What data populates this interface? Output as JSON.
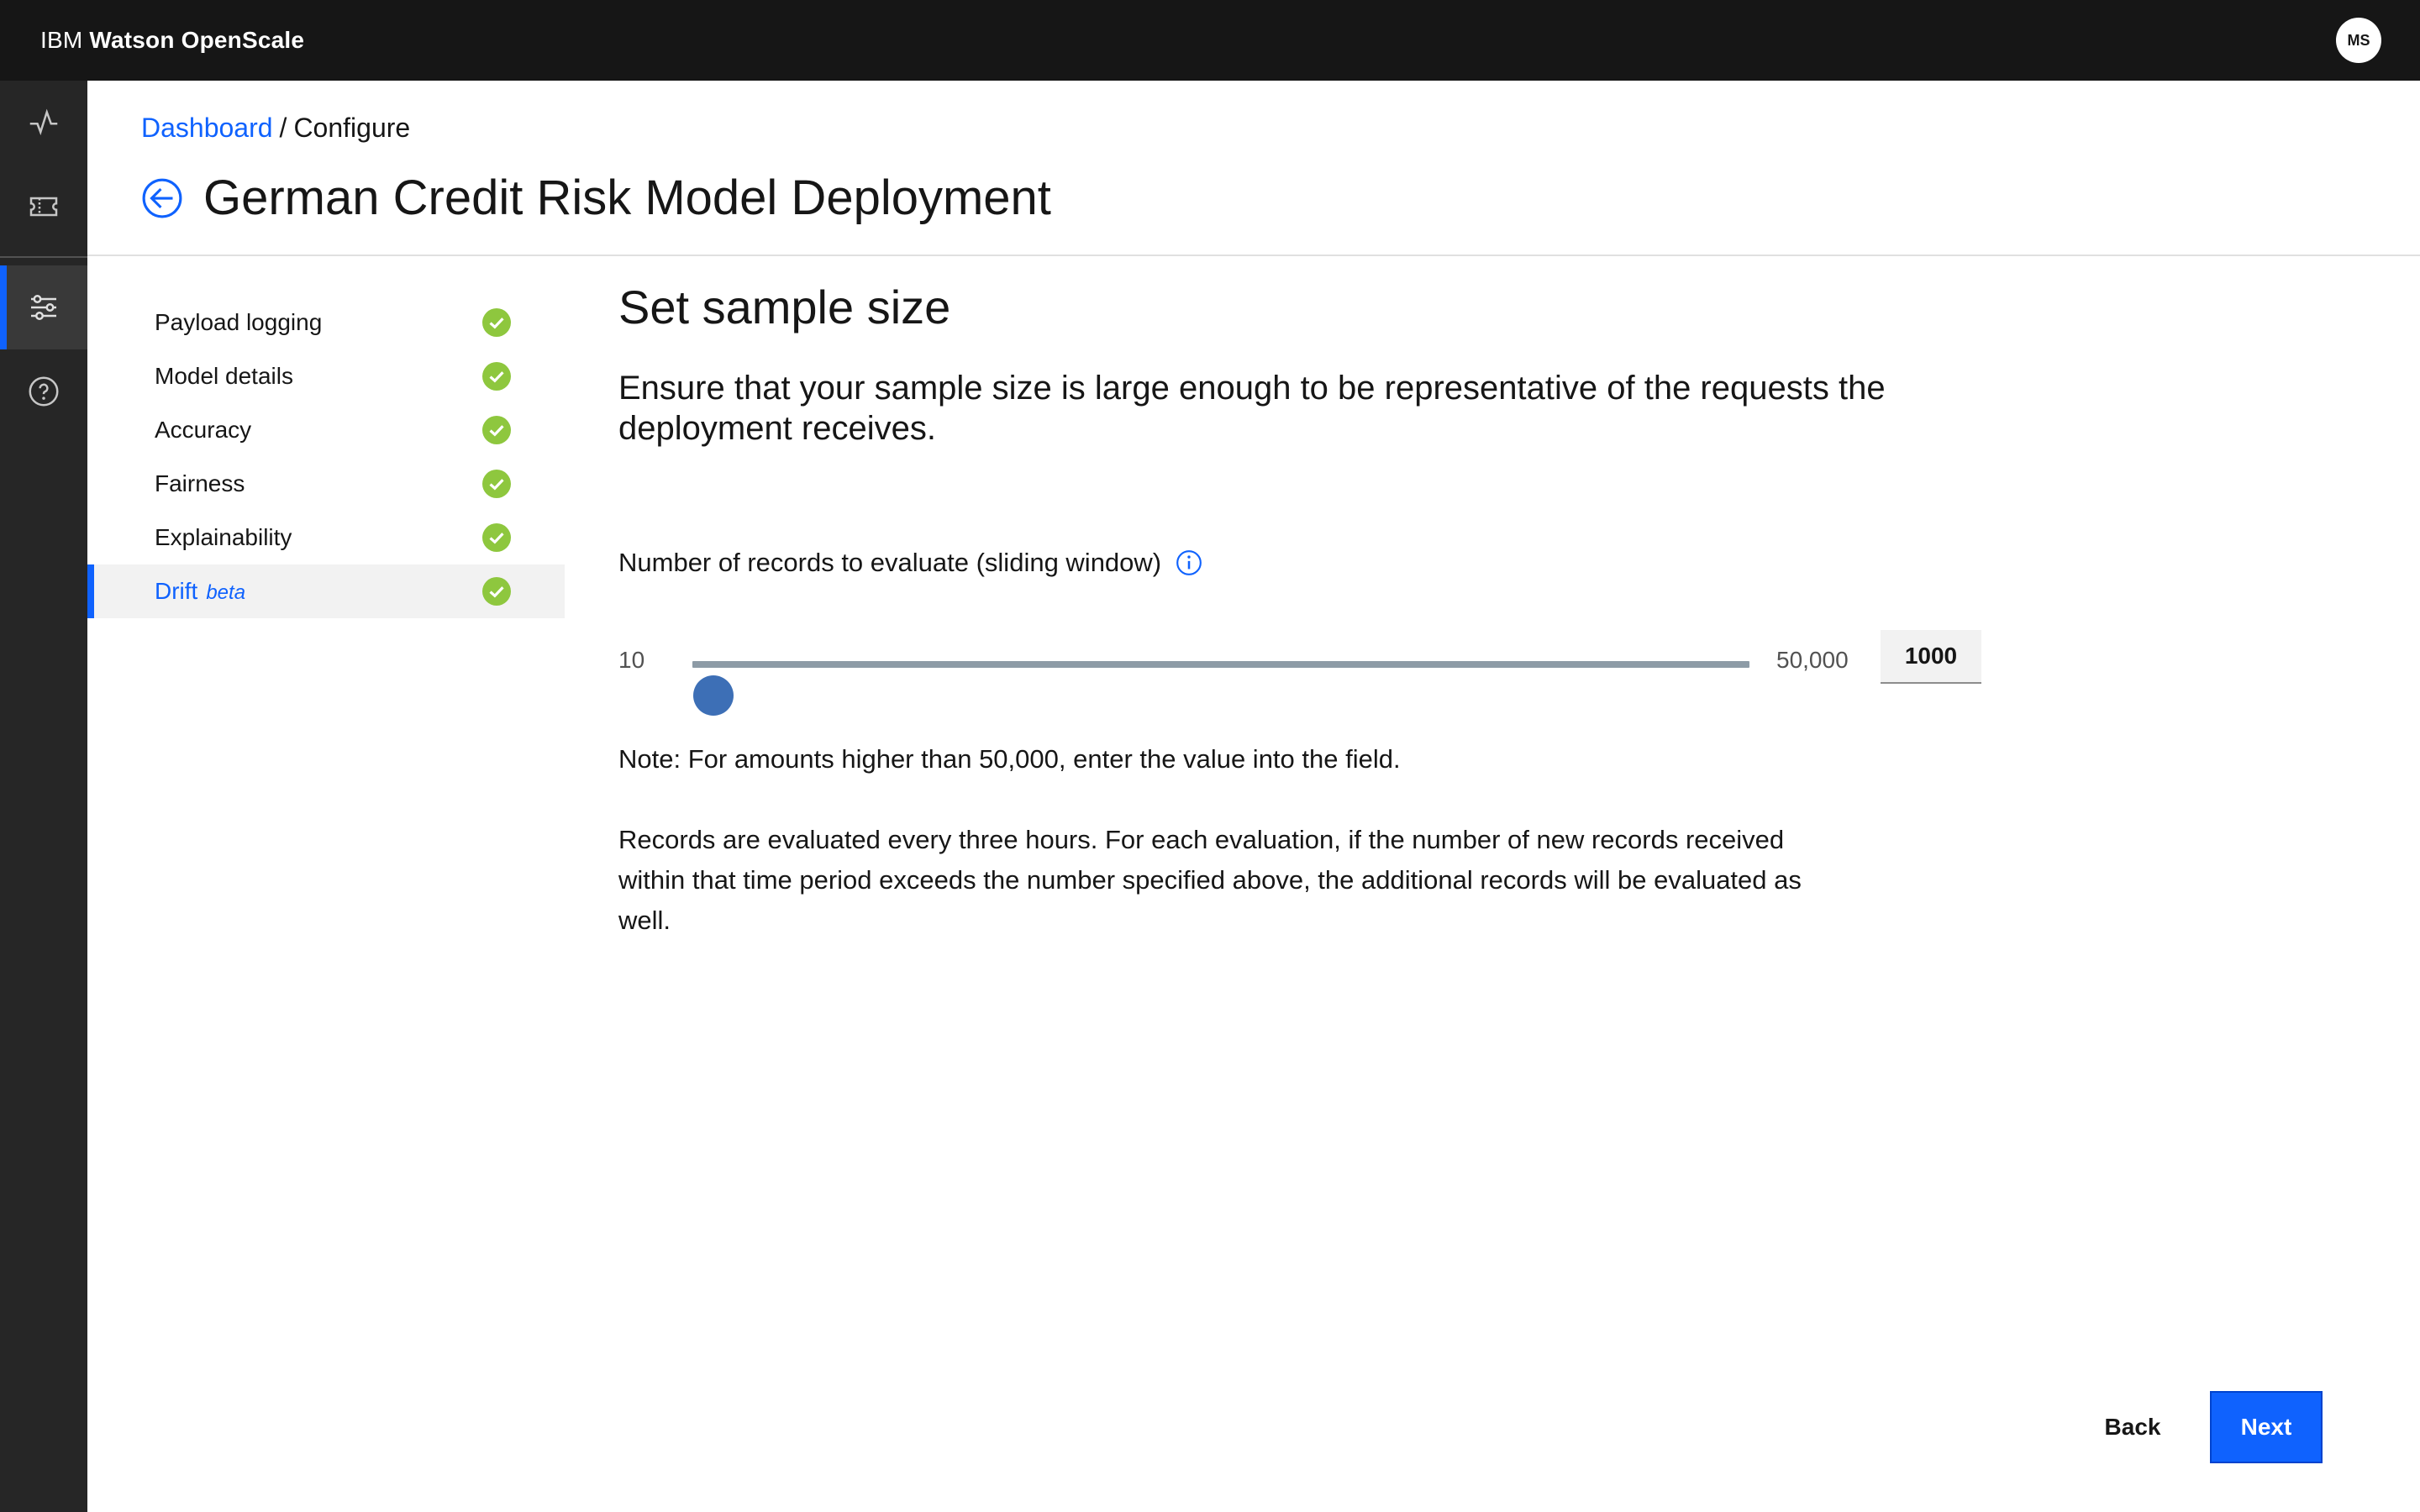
{
  "header": {
    "brand_prefix": "IBM",
    "brand_name": "Watson OpenScale",
    "avatar_initials": "MS"
  },
  "rail": {
    "items": [
      {
        "icon": "activity-icon"
      },
      {
        "icon": "ticket-icon"
      },
      {
        "icon": "settings-adjust-icon",
        "active": true
      },
      {
        "icon": "help-icon"
      }
    ]
  },
  "breadcrumb": {
    "link": "Dashboard",
    "separator": "/",
    "current": "Configure"
  },
  "page": {
    "title": "German Credit Risk Model Deployment"
  },
  "steps": [
    {
      "label": "Payload logging",
      "badge": "",
      "status": "complete",
      "active": false
    },
    {
      "label": "Model details",
      "badge": "",
      "status": "complete",
      "active": false
    },
    {
      "label": "Accuracy",
      "badge": "",
      "status": "complete",
      "active": false
    },
    {
      "label": "Fairness",
      "badge": "",
      "status": "complete",
      "active": false
    },
    {
      "label": "Explainability",
      "badge": "",
      "status": "complete",
      "active": false
    },
    {
      "label": "Drift",
      "badge": "beta",
      "status": "complete",
      "active": true
    }
  ],
  "main": {
    "title": "Set sample size",
    "description": "Ensure that your sample size is large enough to be representative of the requests the deployment receives.",
    "field_label": "Number of records to evaluate (sliding window)",
    "slider": {
      "min_label": "10",
      "max_label": "50,000",
      "min": 10,
      "max": 50000,
      "value": 1000,
      "input_value": "1000"
    },
    "note": "Note: For amounts higher than 50,000, enter the value into the field.",
    "records_text": "Records are evaluated every three hours. For each evaluation, if the number of new records received within that time period exceeds the number specified above, the additional records will be evaluated as well."
  },
  "footer": {
    "back_label": "Back",
    "next_label": "Next"
  },
  "colors": {
    "accent": "#0f62fe",
    "success": "#8ec73e",
    "topbar": "#161616",
    "rail": "#262626"
  }
}
